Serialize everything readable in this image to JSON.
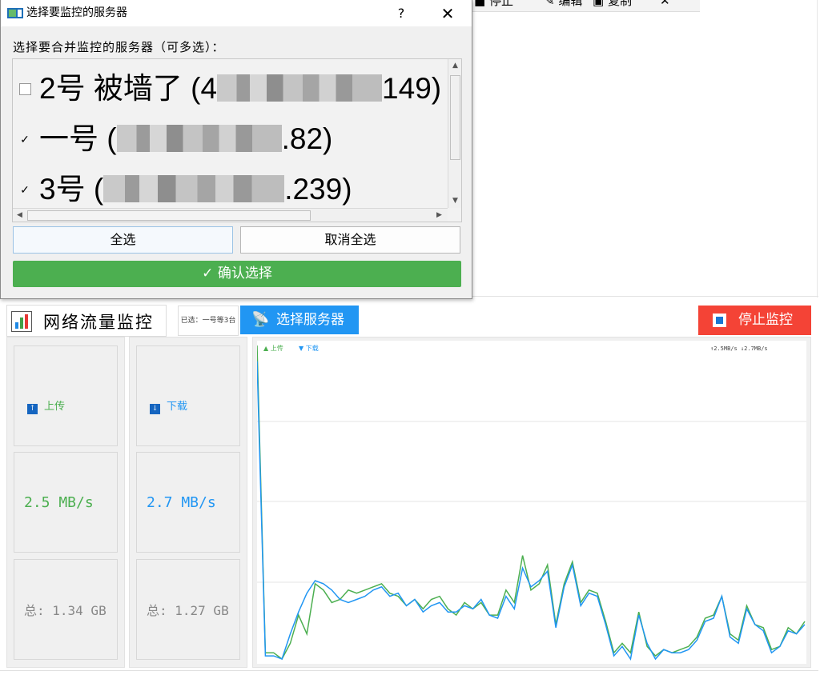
{
  "background_toolbar": {
    "items": [
      {
        "icon": "stop-square-icon",
        "label": "停止"
      },
      {
        "icon": "edit-icon",
        "label": "编辑"
      },
      {
        "icon": "copy-icon",
        "label": "复制"
      },
      {
        "icon": "close-icon",
        "label": "✕"
      }
    ]
  },
  "dialog": {
    "title": "选择要监控的服务器",
    "help": "?",
    "close": "✕",
    "prompt": "选择要合并监控的服务器（可多选）：",
    "servers": [
      {
        "checked": false,
        "name_prefix": "2号 被墙了 (4",
        "name_suffix": "149)"
      },
      {
        "checked": true,
        "name_prefix": "一号 (",
        "name_suffix": ".82)"
      },
      {
        "checked": true,
        "name_prefix": "3号 (",
        "name_suffix": ".239)"
      }
    ],
    "select_all": "全选",
    "deselect_all": "取消全选",
    "confirm": "✓  确认选择"
  },
  "monitor": {
    "title": "网络流量监控",
    "selected_note": "已选：一号等3台",
    "select_server": "选择服务器",
    "stop": "停止监控",
    "upload": {
      "title": "上传",
      "speed": "2.5 MB/s",
      "total": "总: 1.34 GB",
      "color": "#4caf50"
    },
    "download": {
      "title": "下载",
      "speed": "2.7 MB/s",
      "total": "总: 1.27 GB",
      "color": "#2196f3"
    }
  },
  "chart_data": {
    "type": "line",
    "legend": [
      "▲ 上传",
      "▼ 下载"
    ],
    "legend_placement": "top-left",
    "readout": "↑2.5MB/s  ↓2.7MB/s",
    "grid": true,
    "ylim": [
      0,
      100
    ],
    "series": [
      {
        "name": "上传",
        "color": "#4caf50",
        "values": [
          100,
          2,
          2,
          0,
          5,
          14,
          8,
          24,
          22,
          18,
          19,
          22,
          21,
          22,
          23,
          24,
          21,
          20,
          17,
          19,
          16,
          19,
          20,
          16,
          14,
          18,
          16,
          18,
          14,
          14,
          22,
          18,
          33,
          22,
          24,
          30,
          11,
          24,
          31,
          18,
          22,
          21,
          12,
          2,
          5,
          2,
          15,
          4,
          1,
          3,
          2,
          3,
          4,
          7,
          13,
          14,
          20,
          8,
          6,
          17,
          11,
          10,
          3,
          4,
          10,
          8,
          12
        ]
      },
      {
        "name": "下载",
        "color": "#2196f3",
        "values": [
          95,
          1,
          1,
          0,
          8,
          15,
          21,
          25,
          24,
          22,
          19,
          18,
          19,
          20,
          22,
          23,
          20,
          21,
          17,
          19,
          15,
          17,
          18,
          15,
          15,
          17,
          16,
          19,
          14,
          13,
          20,
          16,
          29,
          23,
          25,
          28,
          10,
          23,
          30,
          17,
          21,
          20,
          11,
          1,
          4,
          0,
          14,
          5,
          0,
          3,
          2,
          2,
          3,
          6,
          12,
          13,
          20,
          7,
          5,
          16,
          11,
          9,
          2,
          4,
          9,
          8,
          11
        ]
      }
    ]
  }
}
